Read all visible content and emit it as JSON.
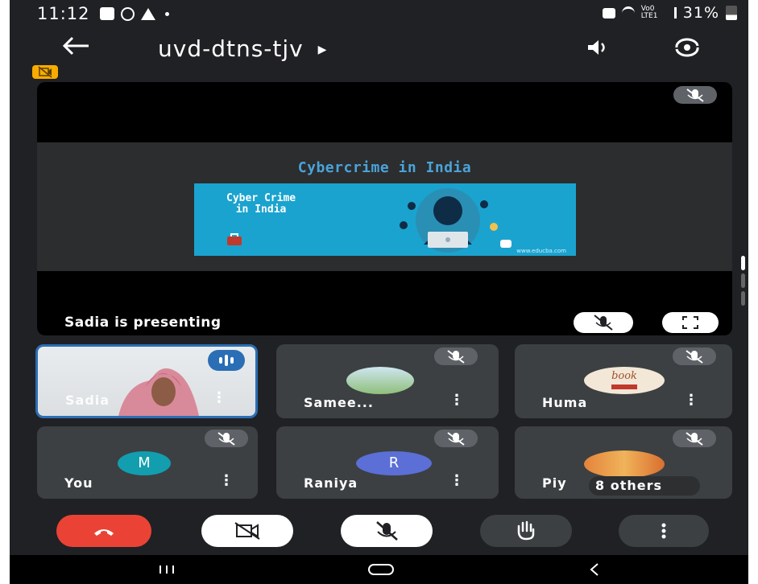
{
  "status_bar": {
    "time": "11:12",
    "network": "Vo0 LTE1",
    "battery": "31%"
  },
  "app_bar": {
    "meeting_code": "uvd-dtns-tjv"
  },
  "presentation": {
    "slide_title": "Cybercrime in India",
    "slide_image_text_line1": "Cyber Crime",
    "slide_image_text_line2": "in India",
    "slide_image_url": "www.educba.com",
    "presenting_label": "Sadia is presenting"
  },
  "participants": [
    {
      "name": "Sadia"
    },
    {
      "name": "Samee..."
    },
    {
      "name": "Huma",
      "avatar_text": "book"
    },
    {
      "name": "You",
      "initial": "M"
    },
    {
      "name": "Raniya",
      "initial": "R"
    },
    {
      "name": "Piy… 8 others",
      "name_short": "Piy",
      "others": "8 others"
    }
  ],
  "colors": {
    "end_call": "#ea4335",
    "avatar_you": "#129eaf",
    "avatar_raniya": "#5b6fd6",
    "speaking_border": "#2a6fb5",
    "camera_badge": "#f9ab00"
  },
  "icons": {
    "back": "arrow-left-icon",
    "speaker": "speaker-icon",
    "flip_camera": "flip-camera-icon",
    "mic_off": "mic-off-icon",
    "camera_off": "camera-off-icon",
    "raise_hand": "hand-icon",
    "more": "more-vert-icon",
    "end_call": "phone-hangup-icon"
  }
}
